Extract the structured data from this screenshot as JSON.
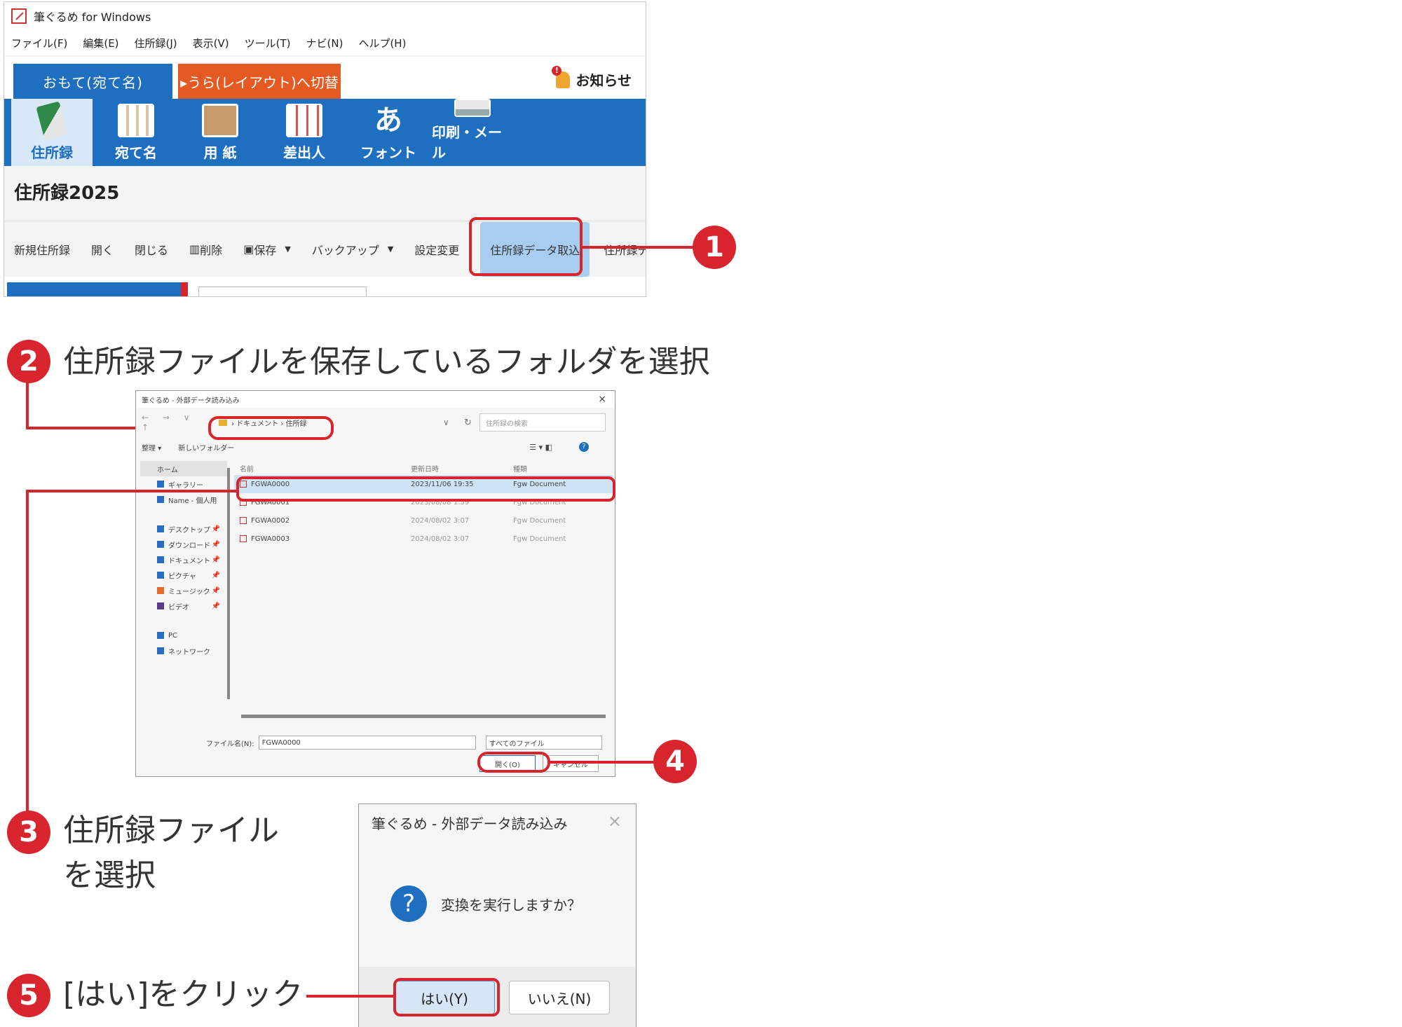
{
  "app": {
    "title": "筆ぐるめ for Windows",
    "menus": [
      "ファイル(F)",
      "編集(E)",
      "住所録(J)",
      "表示(V)",
      "ツール(T)",
      "ナビ(N)",
      "ヘルプ(H)"
    ],
    "tab_front": "おもて(宛て名)",
    "tab_back": "▸うら(レイアウト)へ切替",
    "notice": "お知らせ",
    "toolbar": [
      "住所録",
      "宛て名",
      "用 紙",
      "差出人",
      "フォント",
      "印刷・メール"
    ],
    "font_glyph": "あ",
    "doc_title": "住所録2025",
    "commands": {
      "new": "新規住所録",
      "open": "開く",
      "close": "閉じる",
      "delete": "削除",
      "save": "保存",
      "backup": "バックアップ",
      "settings": "設定変更",
      "import": "住所録データ取込",
      "cut": "住所録デ"
    },
    "caret": "▼"
  },
  "steps": {
    "s1": "1",
    "s2": "2",
    "s2_text": "住所録ファイルを保存しているフォルダを選択",
    "s3": "3",
    "s3_text_line1": "住所録ファイル",
    "s3_text_line2": "を選択",
    "s4": "4",
    "s5": "5",
    "s5_text": "[はい]をクリック"
  },
  "file_dialog": {
    "title": "筆ぐるめ - 外部データ読み込み",
    "close": "×",
    "nav_arrows": "← → ∨ ↑",
    "path": "› ドキュメント › 住所録",
    "chevron": "∨",
    "refresh": "↻",
    "search_placeholder": "住所録の検索",
    "cmd_organize": "整理 ▾",
    "cmd_newfolder": "新しいフォルダー",
    "view_icons": "☰ ▾   ◧",
    "help": "?",
    "nav": {
      "home": "ホーム",
      "gallery": "ギャラリー",
      "cloud": "Name - 個人用",
      "desktop": "デスクトップ",
      "downloads": "ダウンロード",
      "documents": "ドキュメント",
      "pictures": "ピクチャ",
      "music": "ミュージック",
      "videos": "ビデオ",
      "pc": "PC",
      "network": "ネットワーク",
      "pin": "📌"
    },
    "columns": [
      "名前",
      "更新日時",
      "種類"
    ],
    "files": [
      {
        "name": "FGWA0000",
        "date": "2023/11/06 19:35",
        "type": "Fgw Document"
      },
      {
        "name": "FGWA0001",
        "date": "2023/08/08 1:59",
        "type": "Fgw Document"
      },
      {
        "name": "FGWA0002",
        "date": "2024/08/02 3:07",
        "type": "Fgw Document"
      },
      {
        "name": "FGWA0003",
        "date": "2024/08/02 3:07",
        "type": "Fgw Document"
      }
    ],
    "filename_label": "ファイル名(N):",
    "filename_value": "FGWA0000",
    "filetype_value": "すべてのファイル",
    "open_button": "開く(O)",
    "cancel_button": "キャンセル"
  },
  "confirm_dialog": {
    "title": "筆ぐるめ - 外部データ読み込み",
    "close": "×",
    "icon": "?",
    "message": "変換を実行しますか？",
    "yes": "はい(Y)",
    "no": "いいえ(N)"
  },
  "colors": {
    "accent": "#d8242d",
    "brand": "#1f6fc0",
    "orange": "#e55a23"
  }
}
